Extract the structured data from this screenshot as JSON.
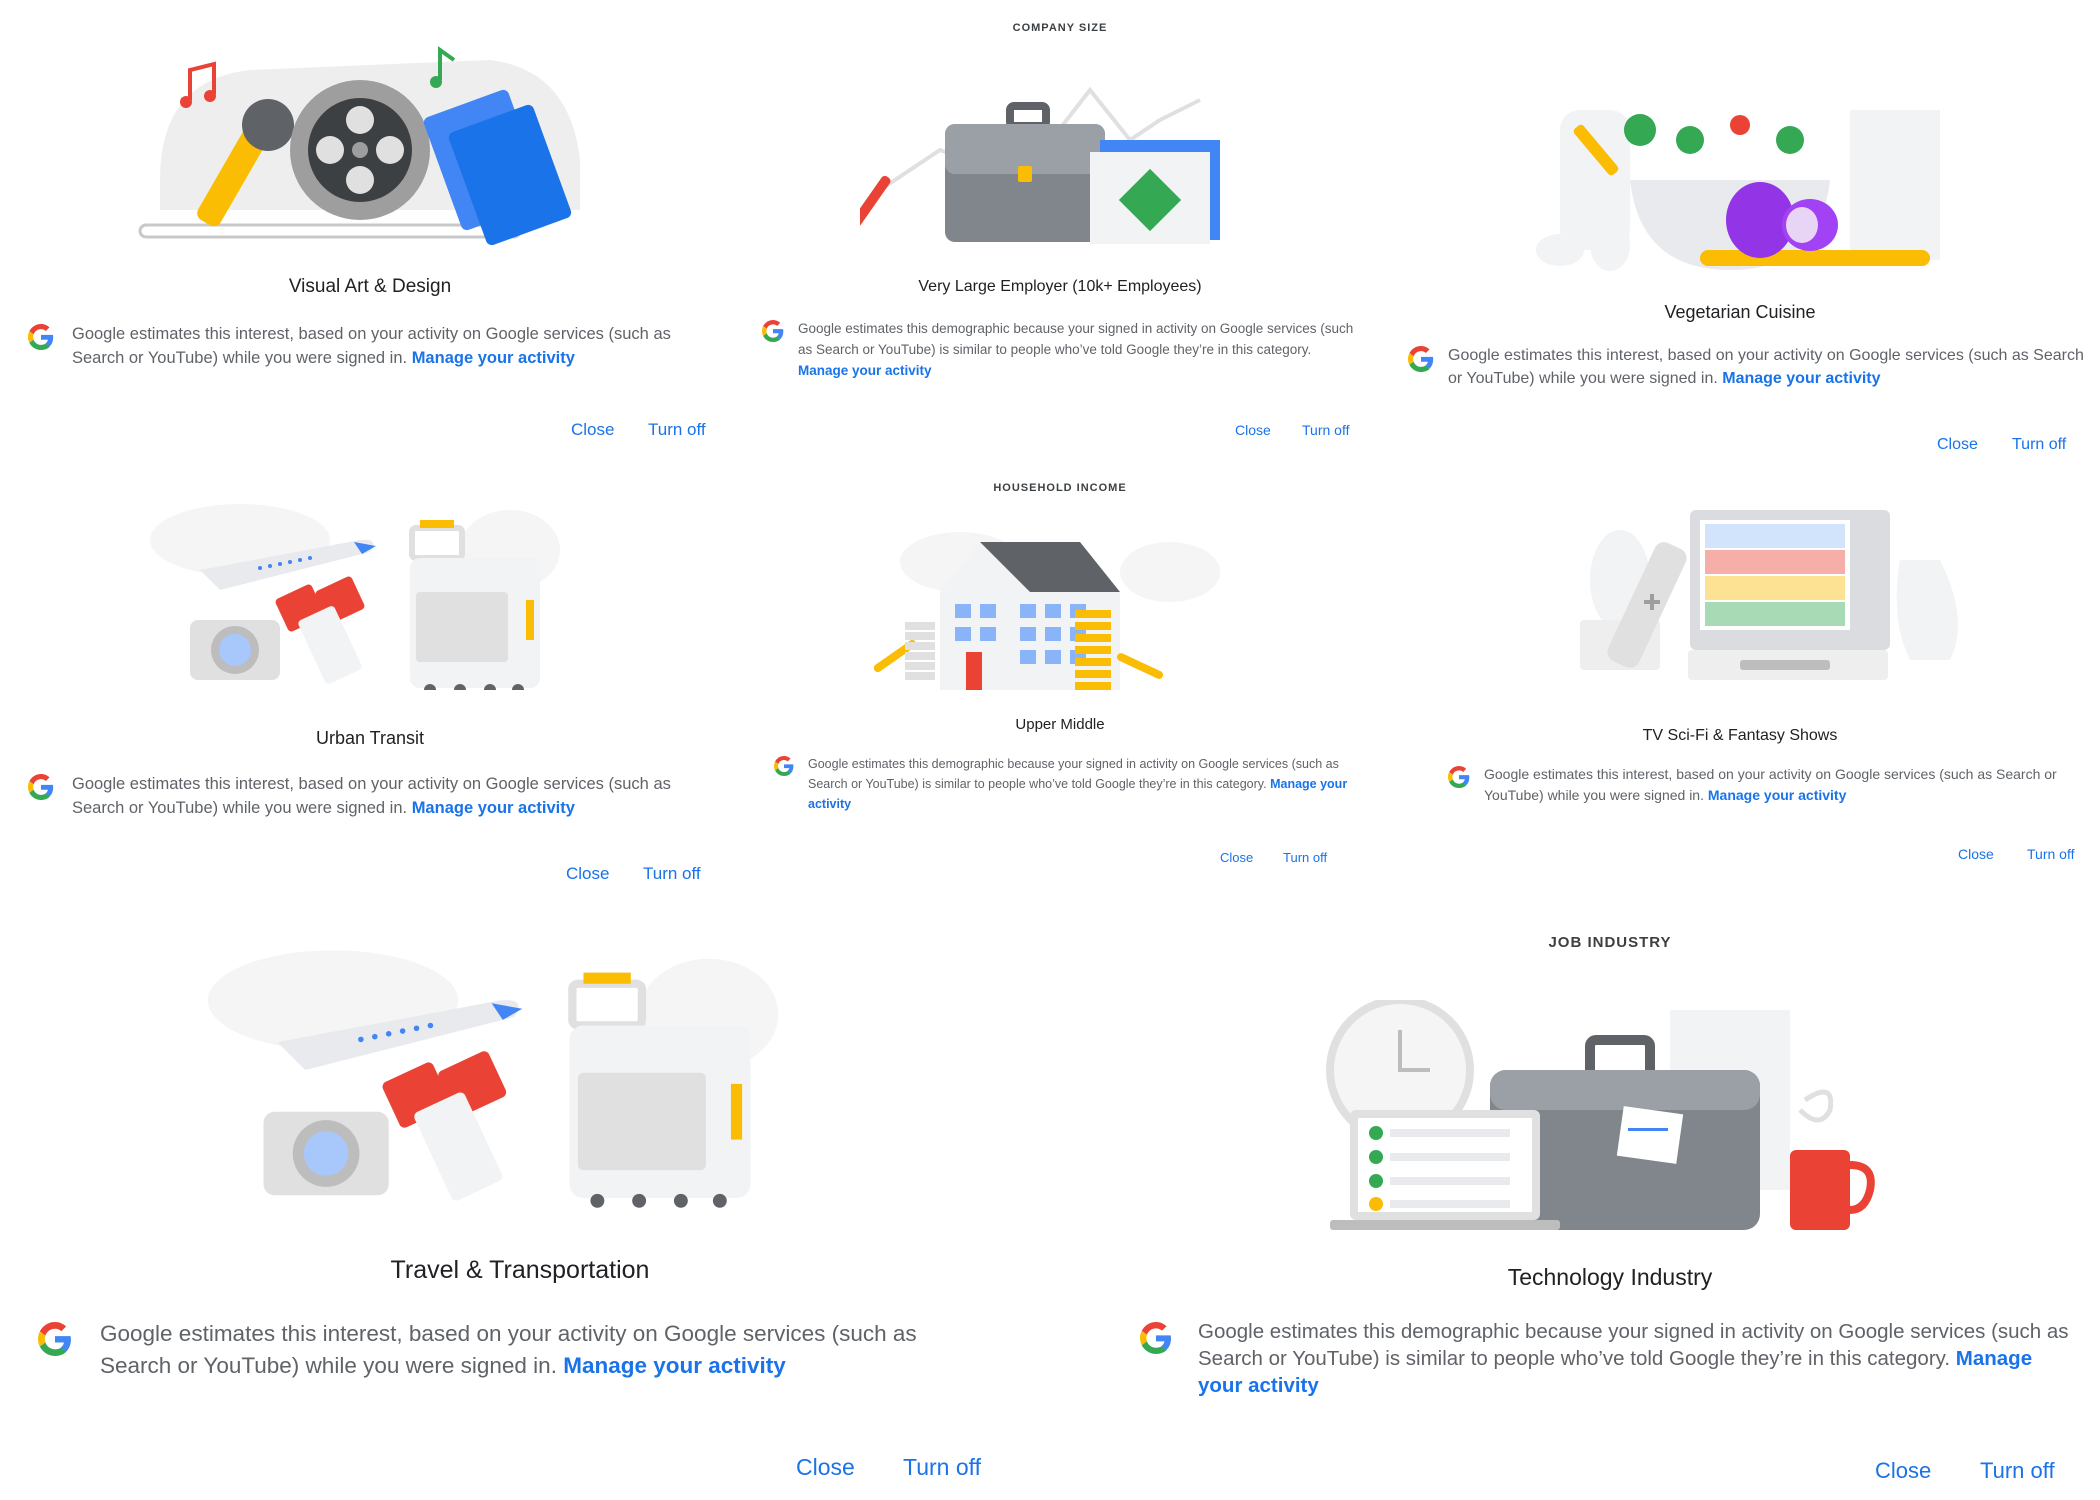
{
  "cards": [
    {
      "eyebrow": "",
      "title": "Visual Art & Design",
      "text": "Google estimates this interest, based on your activity on Google services (such as Search or YouTube) while you were signed in.",
      "link": "Manage your activity",
      "close": "Close",
      "turnoff": "Turn off",
      "illustration": "art-design-illustration"
    },
    {
      "eyebrow": "COMPANY SIZE",
      "title": "Very Large Employer (10k+ Employees)",
      "text": "Google estimates this demographic because your signed in activity on Google services (such as Search or YouTube) is similar to people who’ve told Google they’re in this category.",
      "link": "Manage your activity",
      "close": "Close",
      "turnoff": "Turn off",
      "illustration": "briefcase-illustration"
    },
    {
      "eyebrow": "",
      "title": "Vegetarian Cuisine",
      "text": "Google estimates this interest, based on your activity on Google services (such as Search or YouTube) while you were signed in.",
      "link": "Manage your activity",
      "close": "Close",
      "turnoff": "Turn off",
      "illustration": "salad-bowl-illustration"
    },
    {
      "eyebrow": "",
      "title": "Urban Transit",
      "text": "Google estimates this interest, based on your activity on Google services (such as Search or YouTube) while you were signed in.",
      "link": "Manage your activity",
      "close": "Close",
      "turnoff": "Turn off",
      "illustration": "travel-illustration"
    },
    {
      "eyebrow": "HOUSEHOLD INCOME",
      "title": "Upper Middle",
      "text": "Google estimates this demographic because your signed in activity on Google services (such as Search or YouTube) is similar to people who’ve told Google they’re in this category.",
      "link": "Manage your activity",
      "close": "Close",
      "turnoff": "Turn off",
      "illustration": "house-coins-illustration"
    },
    {
      "eyebrow": "",
      "title": "TV Sci-Fi & Fantasy Shows",
      "text": "Google estimates this interest, based on your activity on Google services (such as Search or YouTube) while you were signed in.",
      "link": "Manage your activity",
      "close": "Close",
      "turnoff": "Turn off",
      "illustration": "tv-remote-illustration"
    },
    {
      "eyebrow": "",
      "title": "Travel & Transportation",
      "text": "Google estimates this interest, based on your activity on Google services (such as Search or YouTube) while you were signed in.",
      "link": "Manage your activity",
      "close": "Close",
      "turnoff": "Turn off",
      "illustration": "travel-illustration"
    },
    {
      "eyebrow": "JOB INDUSTRY",
      "title": "Technology Industry",
      "text": "Google estimates this demographic because your signed in activity on Google services (such as Search or YouTube) is similar to people who’ve told Google they’re in this category.",
      "link": "Manage your activity",
      "close": "Close",
      "turnoff": "Turn off",
      "illustration": "office-laptop-illustration"
    }
  ],
  "colors": {
    "accent": "#1a73e8",
    "google_blue": "#4285f4",
    "google_red": "#ea4335",
    "google_yellow": "#fbbc04",
    "google_green": "#34a853"
  }
}
